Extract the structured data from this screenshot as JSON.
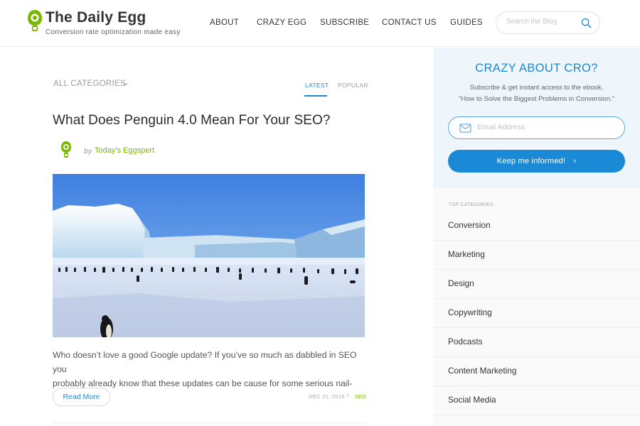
{
  "header": {
    "logo_title": "The Daily Egg",
    "tagline": "Conversion rate optimization made easy",
    "logo_icon": "egg-logo-icon",
    "nav": [
      "ABOUT",
      "CRAZY EGG",
      "SUBSCRIBE",
      "CONTACT US",
      "GUIDES"
    ],
    "search_placeholder": "Search the Blog",
    "search_icon": "search-icon"
  },
  "filters": {
    "category_label": "ALL CATEGORIES",
    "tabs": [
      "LATEST",
      "POPULAR"
    ],
    "active_tab": "LATEST"
  },
  "post": {
    "title": "What Does Penguin 4.0 Mean For Your SEO?",
    "by": "by",
    "author": "Today's Eggspert",
    "image": "penguins-on-antarctic-ice",
    "excerpt_line1": "Who doesn’t love a good Google update? If you’ve so much as dabbled in SEO you",
    "excerpt_line2": "probably already know that these updates can be cause for some serious nail-biting.",
    "read_more": "Read More",
    "date": "DEC 21, 2016",
    "separator": "›",
    "tag": "SEO"
  },
  "sidebar": {
    "cro_title": "CRAZY ABOUT CRO?",
    "cro_line1": "Subscribe & get instant access to the ebook,",
    "cro_line2": "\"How to Solve the Biggest Problems in Conversion.\"",
    "email_placeholder": "Email Address",
    "button_label": "Keep me informed!",
    "button_arrow": "›",
    "top_categories_heading": "TOP CATEGORIES",
    "categories": [
      "Conversion",
      "Marketing",
      "Design",
      "Copywriting",
      "Podcasts",
      "Content Marketing",
      "Social Media"
    ]
  },
  "colors": {
    "accent_blue": "#1b8ad6",
    "accent_green": "#7ab800",
    "cro_box_bg": "#eef5fb",
    "sidebar_bg": "#fafafa"
  }
}
